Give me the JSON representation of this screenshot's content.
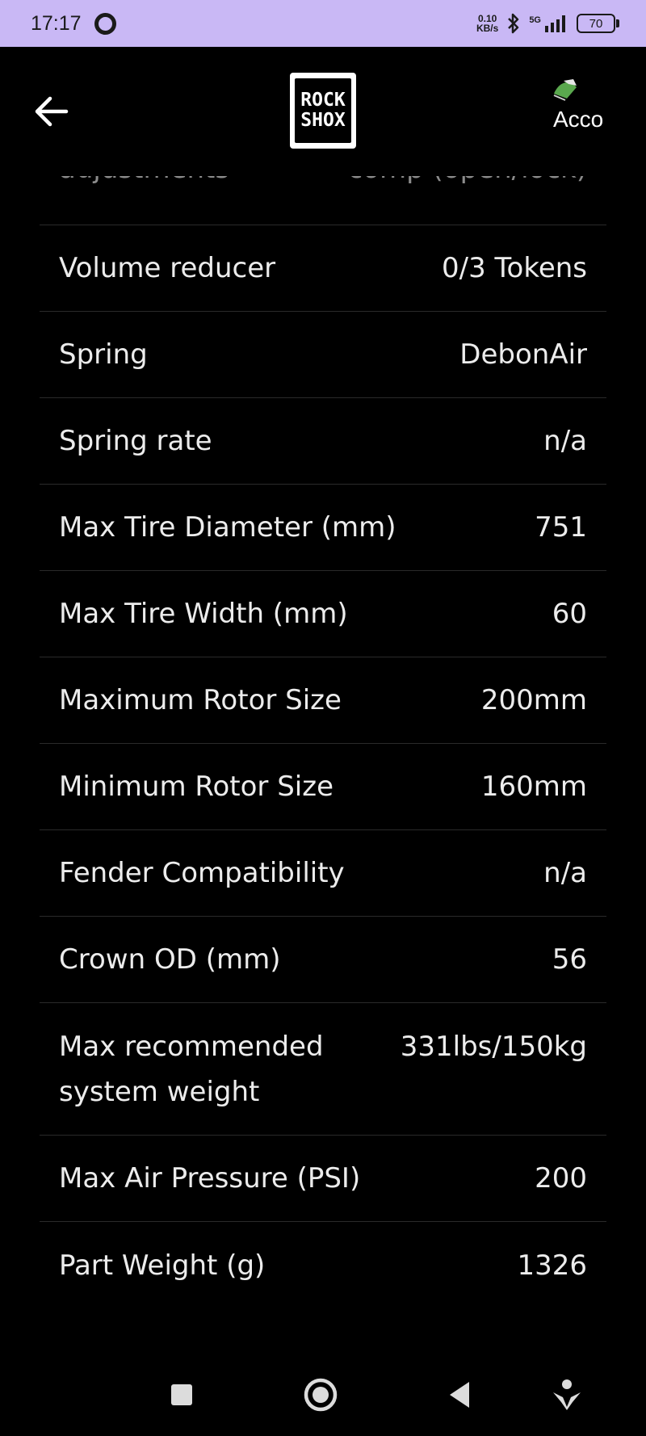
{
  "status_bar": {
    "time": "17:17",
    "speed_value": "0.10",
    "speed_unit": "KB/s",
    "network": "5G",
    "battery": "70"
  },
  "app_bar": {
    "logo_line1": "ROCK",
    "logo_line2": "SHOX",
    "account_text": "Acco"
  },
  "specs": [
    {
      "label": "adjustments",
      "value": "comp (open/lock)"
    },
    {
      "label": "Volume reducer",
      "value": "0/3 Tokens"
    },
    {
      "label": "Spring",
      "value": "DebonAir"
    },
    {
      "label": "Spring rate",
      "value": "n/a"
    },
    {
      "label": "Max Tire Diameter (mm)",
      "value": "751"
    },
    {
      "label": "Max Tire Width (mm)",
      "value": "60"
    },
    {
      "label": "Maximum Rotor Size",
      "value": "200mm"
    },
    {
      "label": "Minimum Rotor Size",
      "value": "160mm"
    },
    {
      "label": "Fender Compatibility",
      "value": "n/a"
    },
    {
      "label": "Crown OD (mm)",
      "value": "56"
    },
    {
      "label": "Max recommended system weight",
      "value": "331lbs/150kg"
    },
    {
      "label": "Max Air Pressure (PSI)",
      "value": "200"
    },
    {
      "label": "Part Weight (g)",
      "value": "1326"
    }
  ],
  "colors": {
    "status_bar_bg": "#c9b8f5",
    "background": "#000000",
    "text": "#ececec",
    "divider": "#2a2a2a"
  }
}
